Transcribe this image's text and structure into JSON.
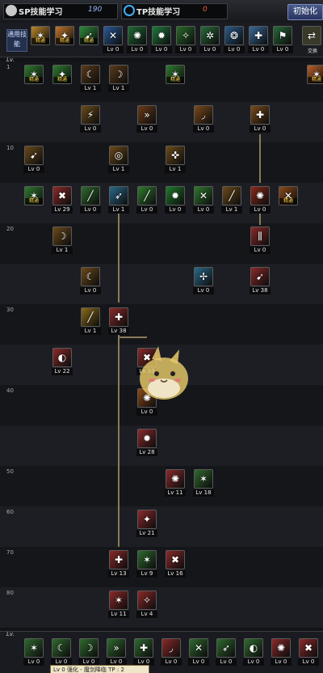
{
  "topbar": {
    "sp_label": "SP技能学习",
    "sp_value": "190",
    "tp_label": "TP技能学习",
    "tp_value": "0",
    "init_button": "初始化"
  },
  "quickslot": {
    "label": "通用技能",
    "swap_label": "交换",
    "items": [
      {
        "glyph": "✶",
        "color": "#b8862a",
        "tag": "精通"
      },
      {
        "glyph": "✦",
        "color": "#c2762a",
        "tag": "精通"
      },
      {
        "glyph": "➹",
        "color": "#2f8a3a",
        "tag": "精通"
      },
      {
        "glyph": "✕",
        "color": "#2a5a9a",
        "lv": "Lv 0"
      },
      {
        "glyph": "✺",
        "color": "#1f6a34",
        "lv": "Lv 0"
      },
      {
        "glyph": "✹",
        "color": "#1f7a3a",
        "lv": "Lv 0"
      },
      {
        "glyph": "✧",
        "color": "#2a6a2a",
        "lv": "Lv 0"
      },
      {
        "glyph": "✲",
        "color": "#2a6a3a",
        "lv": "Lv 0"
      },
      {
        "glyph": "❂",
        "color": "#2a5a8a",
        "lv": "Lv 0"
      },
      {
        "glyph": "✚",
        "color": "#3a6a9a",
        "lv": "Lv 0"
      },
      {
        "glyph": "⚑",
        "color": "#2a6a3a",
        "lv": "Lv 0"
      }
    ]
  },
  "level_header": "Lv.",
  "levels": [
    "1",
    "10",
    "20",
    "30",
    "40",
    "50",
    "60",
    "70",
    "80"
  ],
  "skills": [
    {
      "row": 0,
      "col": 0,
      "glyph": "✶",
      "color": "#2f7a2f",
      "tag": "精通"
    },
    {
      "row": 0,
      "col": 1,
      "glyph": "✦",
      "color": "#2f7a2f",
      "tag": "精通"
    },
    {
      "row": 0,
      "col": 2,
      "glyph": "☾",
      "color": "#5a3a1a",
      "lv": "Lv 1"
    },
    {
      "row": 0,
      "col": 3,
      "glyph": "☽",
      "color": "#5a3a1a",
      "lv": "Lv 1"
    },
    {
      "row": 0,
      "col": 5,
      "glyph": "✶",
      "color": "#2f7a2f",
      "tag": "精通"
    },
    {
      "row": 0,
      "col": 10,
      "glyph": "✶",
      "color": "#b8602a",
      "tag": "精通"
    },
    {
      "row": 1,
      "col": 2,
      "glyph": "⚡",
      "color": "#6a4a1a",
      "lv": "Lv 0"
    },
    {
      "row": 1,
      "col": 4,
      "glyph": "»",
      "color": "#6a3a1a",
      "lv": "Lv 0"
    },
    {
      "row": 1,
      "col": 6,
      "glyph": "◞",
      "color": "#7a4a1a",
      "lv": "Lv 0"
    },
    {
      "row": 1,
      "col": 8,
      "glyph": "✚",
      "color": "#7a4a1a",
      "lv": "Lv 0"
    },
    {
      "row": 2,
      "col": 0,
      "glyph": "➹",
      "color": "#6a4a1a",
      "lv": "Lv 0"
    },
    {
      "row": 2,
      "col": 3,
      "glyph": "◎",
      "color": "#6a4a1a",
      "lv": "Lv 1"
    },
    {
      "row": 2,
      "col": 5,
      "glyph": "✜",
      "color": "#6a4a1a",
      "lv": "Lv 1"
    },
    {
      "row": 3,
      "col": 0,
      "glyph": "✶",
      "color": "#2f7a2f",
      "tag": "精通"
    },
    {
      "row": 3,
      "col": 1,
      "glyph": "✖",
      "color": "#8a2a2a",
      "lv": "Lv 29"
    },
    {
      "row": 3,
      "col": 2,
      "glyph": "╱",
      "color": "#2f6a2f",
      "lv": "Lv 0"
    },
    {
      "row": 3,
      "col": 3,
      "glyph": "➶",
      "color": "#2a6a8a",
      "lv": "Lv 1"
    },
    {
      "row": 3,
      "col": 4,
      "glyph": "╱",
      "color": "#2f7a2f",
      "lv": "Lv 0"
    },
    {
      "row": 3,
      "col": 5,
      "glyph": "✹",
      "color": "#1f7a2a",
      "lv": "Lv 0"
    },
    {
      "row": 3,
      "col": 6,
      "glyph": "✕",
      "color": "#2f7a2f",
      "lv": "Lv 0"
    },
    {
      "row": 3,
      "col": 7,
      "glyph": "╱",
      "color": "#6a4a1a",
      "lv": "Lv 1"
    },
    {
      "row": 3,
      "col": 8,
      "glyph": "✺",
      "color": "#8a2a1a",
      "lv": "Lv 0"
    },
    {
      "row": 3,
      "col": 9,
      "glyph": "✕",
      "color": "#8a4a1a",
      "tag": "精通"
    },
    {
      "row": 4,
      "col": 1,
      "glyph": "☽",
      "color": "#6a4a1a",
      "lv": "Lv 1"
    },
    {
      "row": 4,
      "col": 8,
      "glyph": "⫼",
      "color": "#8a2a2a",
      "lv": "Lv 0"
    },
    {
      "row": 5,
      "col": 2,
      "glyph": "☾",
      "color": "#6a4a1a",
      "lv": "Lv 0"
    },
    {
      "row": 5,
      "col": 6,
      "glyph": "✢",
      "color": "#2a6a8a",
      "lv": "Lv 0"
    },
    {
      "row": 5,
      "col": 8,
      "glyph": "➹",
      "color": "#8a2a2a",
      "lv": "Lv 38"
    },
    {
      "row": 6,
      "col": 2,
      "glyph": "╱",
      "color": "#8a6a1a",
      "lv": "Lv 1"
    },
    {
      "row": 6,
      "col": 3,
      "glyph": "✚",
      "color": "#8a2a2a",
      "lv": "Lv 38"
    },
    {
      "row": 7,
      "col": 1,
      "glyph": "◐",
      "color": "#8a2a2a",
      "lv": "Lv 22"
    },
    {
      "row": 7,
      "col": 4,
      "glyph": "✖",
      "color": "#8a2a2a",
      "lv": "Lv 33"
    },
    {
      "row": 8,
      "col": 4,
      "glyph": "✺",
      "color": "#8a4a1a",
      "lv": "Lv 0"
    },
    {
      "row": 9,
      "col": 4,
      "glyph": "✹",
      "color": "#8a2a2a",
      "lv": "Lv 28"
    },
    {
      "row": 10,
      "col": 5,
      "glyph": "✺",
      "color": "#8a2a2a",
      "lv": "Lv 11"
    },
    {
      "row": 10,
      "col": 6,
      "glyph": "✶",
      "color": "#2f6a2f",
      "lv": "Lv 18"
    },
    {
      "row": 11,
      "col": 4,
      "glyph": "✦",
      "color": "#8a2a2a",
      "lv": "Lv 21"
    },
    {
      "row": 12,
      "col": 3,
      "glyph": "✚",
      "color": "#8a2a2a",
      "lv": "Lv 13"
    },
    {
      "row": 12,
      "col": 4,
      "glyph": "✶",
      "color": "#2f6a2f",
      "lv": "Lv 9"
    },
    {
      "row": 12,
      "col": 5,
      "glyph": "✖",
      "color": "#8a2a2a",
      "lv": "Lv 16"
    },
    {
      "row": 13,
      "col": 3,
      "glyph": "✶",
      "color": "#8a2a2a",
      "lv": "Lv 11"
    },
    {
      "row": 13,
      "col": 4,
      "glyph": "✧",
      "color": "#8a2a2a",
      "lv": "Lv 4"
    }
  ],
  "bottom": {
    "header": "Lv.",
    "items": [
      {
        "glyph": "✶",
        "color": "#2f6a2f",
        "lv": "Lv 0"
      },
      {
        "glyph": "☾",
        "color": "#2f6a2f",
        "lv": "Lv 0"
      },
      {
        "glyph": "☽",
        "color": "#2f6a2f",
        "lv": "Lv 0"
      },
      {
        "glyph": "»",
        "color": "#2f6a2f",
        "lv": "Lv 0"
      },
      {
        "glyph": "✚",
        "color": "#2f6a2f",
        "lv": "Lv 0"
      },
      {
        "glyph": "◞",
        "color": "#8a2a2a",
        "lv": "Lv 0"
      },
      {
        "glyph": "✕",
        "color": "#2f6a2f",
        "lv": "Lv 0"
      },
      {
        "glyph": "➶",
        "color": "#2f6a2f",
        "lv": "Lv 0"
      },
      {
        "glyph": "◐",
        "color": "#2f6a2f",
        "lv": "Lv 0"
      },
      {
        "glyph": "✺",
        "color": "#8a2a2a",
        "lv": "Lv 0"
      },
      {
        "glyph": "✖",
        "color": "#8a2a2a",
        "lv": "Lv 0"
      }
    ],
    "tooltip": "Lv 0 强化 - 魔剑降临 TP : 2"
  }
}
